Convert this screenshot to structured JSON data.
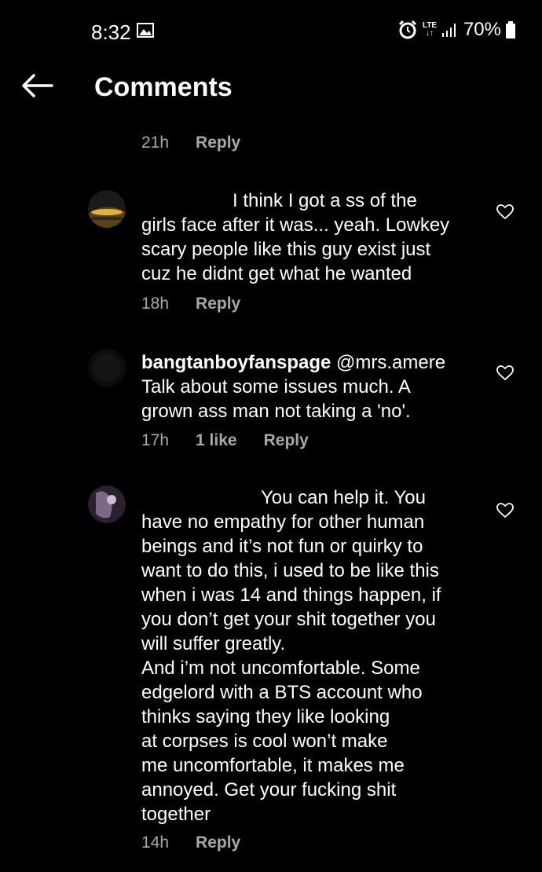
{
  "status": {
    "time": "8:32",
    "network": "LTE",
    "battery": "70%"
  },
  "header": {
    "title": "Comments"
  },
  "top_meta": {
    "time": "21h",
    "reply": "Reply"
  },
  "comments": [
    {
      "text": "I think I got a ss of the\ngirls face after it was... yeah. Lowkey\nscary people like this guy exist just\ncuz he didnt get what he wanted",
      "time": "18h",
      "reply": "Reply"
    },
    {
      "username": "bangtanboyfanspage",
      "text": " @mrs.amere\nTalk about some issues much. A\ngrown ass man not taking a 'no'.",
      "time": "17h",
      "likes": "1 like",
      "reply": "Reply"
    },
    {
      "text": "You can help it. You\nhave no empathy for other human\nbeings and it’s not fun or quirky to\nwant to do this, i used to be like this\nwhen i was 14 and things happen, if\nyou don’t get your shit together you\nwill suffer greatly.\nAnd i’m not uncomfortable. Some\nedgelord with a BTS account who\nthinks saying they like looking\nat corpses is cool won’t make\nme uncomfortable, it makes me\nannoyed. Get your fucking shit\ntogether",
      "time": "14h",
      "reply": "Reply"
    }
  ]
}
